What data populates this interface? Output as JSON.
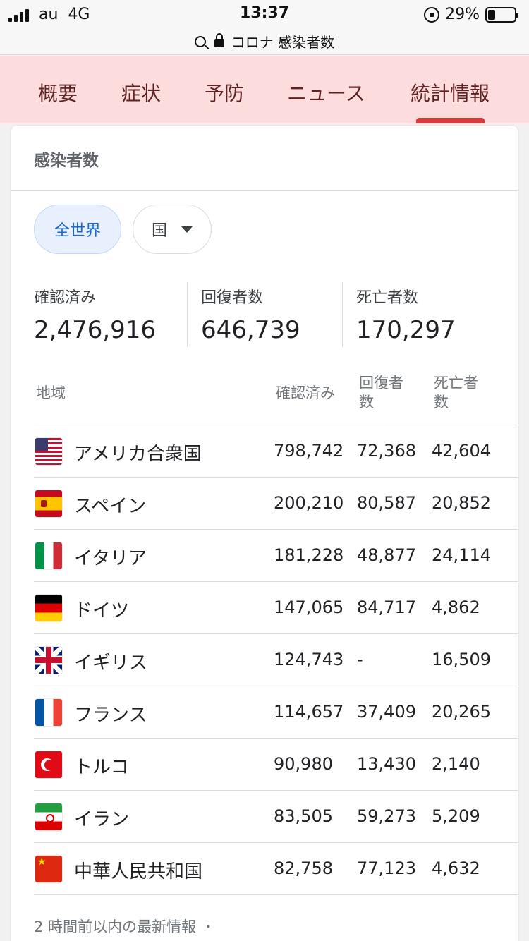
{
  "status_bar": {
    "carrier": "au",
    "network": "4G",
    "time": "13:37",
    "battery_pct": "29%",
    "battery_level": 0.29
  },
  "url_bar": {
    "text": "コロナ 感染者数"
  },
  "tabs": [
    {
      "label": "概要"
    },
    {
      "label": "症状"
    },
    {
      "label": "予防"
    },
    {
      "label": "ニュース"
    },
    {
      "label": "統計情報",
      "active": true
    }
  ],
  "card": {
    "title": "感染者数",
    "chips": {
      "world": "全世界",
      "country": "国"
    },
    "stats": [
      {
        "label": "確認済み",
        "value": "2,476,916"
      },
      {
        "label": "回復者数",
        "value": "646,739"
      },
      {
        "label": "死亡者数",
        "value": "170,297"
      }
    ],
    "table": {
      "headers": [
        "地域",
        "確認済み",
        "回復者数",
        "死亡者数"
      ],
      "header_lines": {
        "region": "地域",
        "confirmed": "確認済み",
        "recovered_1": "回復者",
        "recovered_2": "数",
        "deaths_1": "死亡者",
        "deaths_2": "数"
      },
      "rows": [
        {
          "flag": "us-flag-icon",
          "name": "アメリカ合衆国",
          "confirmed": "798,742",
          "recovered": "72,368",
          "deaths": "42,604"
        },
        {
          "flag": "spain-flag-icon",
          "name": "スペイン",
          "confirmed": "200,210",
          "recovered": "80,587",
          "deaths": "20,852"
        },
        {
          "flag": "italy-flag-icon",
          "name": "イタリア",
          "confirmed": "181,228",
          "recovered": "48,877",
          "deaths": "24,114"
        },
        {
          "flag": "germany-flag-icon",
          "name": "ドイツ",
          "confirmed": "147,065",
          "recovered": "84,717",
          "deaths": "4,862"
        },
        {
          "flag": "uk-flag-icon",
          "name": "イギリス",
          "confirmed": "124,743",
          "recovered": "-",
          "deaths": "16,509"
        },
        {
          "flag": "france-flag-icon",
          "name": "フランス",
          "confirmed": "114,657",
          "recovered": "37,409",
          "deaths": "20,265"
        },
        {
          "flag": "turkey-flag-icon",
          "name": "トルコ",
          "confirmed": "90,980",
          "recovered": "13,430",
          "deaths": "2,140"
        },
        {
          "flag": "iran-flag-icon",
          "name": "イラン",
          "confirmed": "83,505",
          "recovered": "59,273",
          "deaths": "5,209"
        },
        {
          "flag": "china-flag-icon",
          "name": "中華人民共和国",
          "confirmed": "82,758",
          "recovered": "77,123",
          "deaths": "4,632"
        }
      ]
    },
    "footer": "2 時間前以内の最新情報 ・"
  },
  "colors": {
    "tab_bar_bg": "#fcdcdc",
    "tab_indicator": "#d93b3b",
    "chip_active_bg": "#e8f0fe",
    "chip_active_text": "#1967d2"
  }
}
